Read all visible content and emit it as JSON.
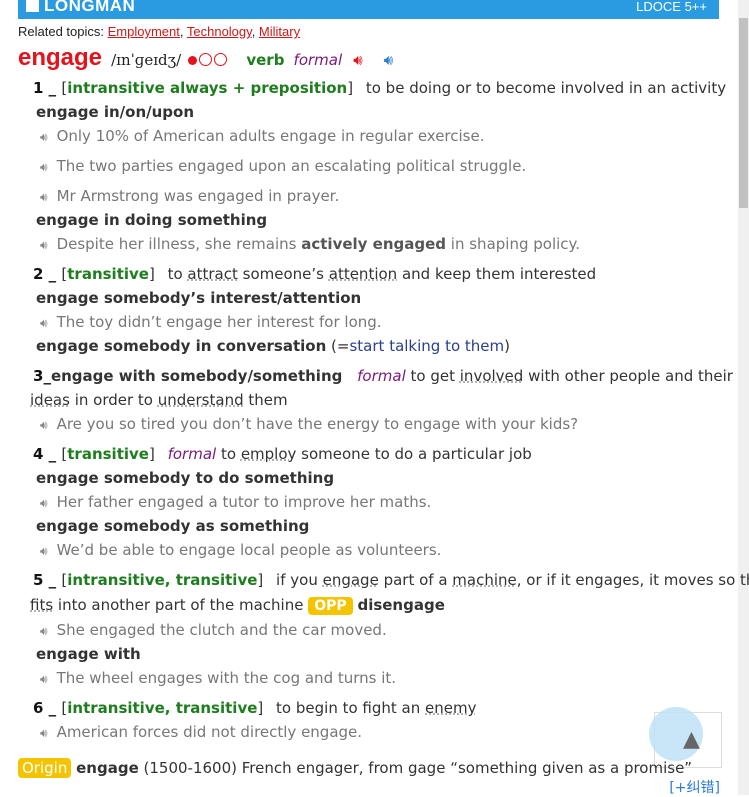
{
  "header": {
    "logo": "LONGMAN",
    "edition": "LDOCE 5++"
  },
  "related": {
    "label": "Related topics:",
    "topics": [
      "Employment",
      "Technology",
      "Military"
    ]
  },
  "entry": {
    "headword": "engage",
    "pron": "/ɪnˈɡeɪdʒ/",
    "pos": "verb",
    "register": "formal"
  },
  "senses": [
    {
      "num": "1",
      "gram": "intransitive always + preposition",
      "def": "to be doing or to become involved in an activity",
      "p1": "engage in/on/upon",
      "e1": "Only 10% of American adults engage in regular exercise.",
      "e2": "The two parties engaged upon an escalating political struggle.",
      "e3": "Mr Armstrong was engaged in prayer.",
      "p2": "engage in doing something",
      "e4a": "Despite her illness, she remains ",
      "e4b": "actively engaged",
      "e4c": " in shaping policy."
    },
    {
      "num": "2",
      "gram": "transitive",
      "d1": "to ",
      "d2": "attract",
      "d3": " someone’s ",
      "d4": "attention",
      "d5": " and keep them interested",
      "p1": "engage somebody’s interest/attention",
      "e1": "The toy didn’t engage her interest for long.",
      "p2": "engage somebody in conversation",
      "p2a": " (=",
      "p2b": "start talking to them",
      "p2c": ")"
    },
    {
      "num": "3",
      "pat": "engage with somebody/something",
      "reg": "formal",
      "d1": " to get ",
      "d2": "involved",
      "d3": " with other people and their",
      "d4": "ideas",
      "d5": " in order to ",
      "d6": "understand",
      "d7": " them",
      "e1": "Are you so tired you don’t have the energy to engage with your kids?"
    },
    {
      "num": "4",
      "gram": "transitive",
      "reg": "formal",
      "d1": " to ",
      "d2": "employ",
      "d3": " someone to do a particular job",
      "p1": "engage somebody to do something",
      "e1": "Her father engaged a tutor to improve her maths.",
      "p2": "engage somebody as something",
      "e2": "We’d be able to engage local people as volunteers."
    },
    {
      "num": "5",
      "gram": "intransitive, transitive",
      "d1": "if you ",
      "d2": "engage",
      "d3": " part of a ",
      "d4": "machine",
      "d5": ", or if it engages, it moves so that it",
      "d6": "fits",
      "d7": " into another part of the machine ",
      "opp": "OPP",
      "oppword": "disengage",
      "e1": "She engaged the clutch and the car moved.",
      "p1": "engage with",
      "e2": "The wheel engages with the cog and turns it."
    },
    {
      "num": "6",
      "gram": "intransitive, transitive",
      "d1": "to begin to fight an ",
      "d2": "enemy",
      "e1": "American forces did not directly engage."
    }
  ],
  "origin": {
    "tag": "Origin",
    "word": "engage",
    "text": " (1500-1600) French engager, from gage “something given as a promise”"
  },
  "correct_link": "[+纠错]"
}
